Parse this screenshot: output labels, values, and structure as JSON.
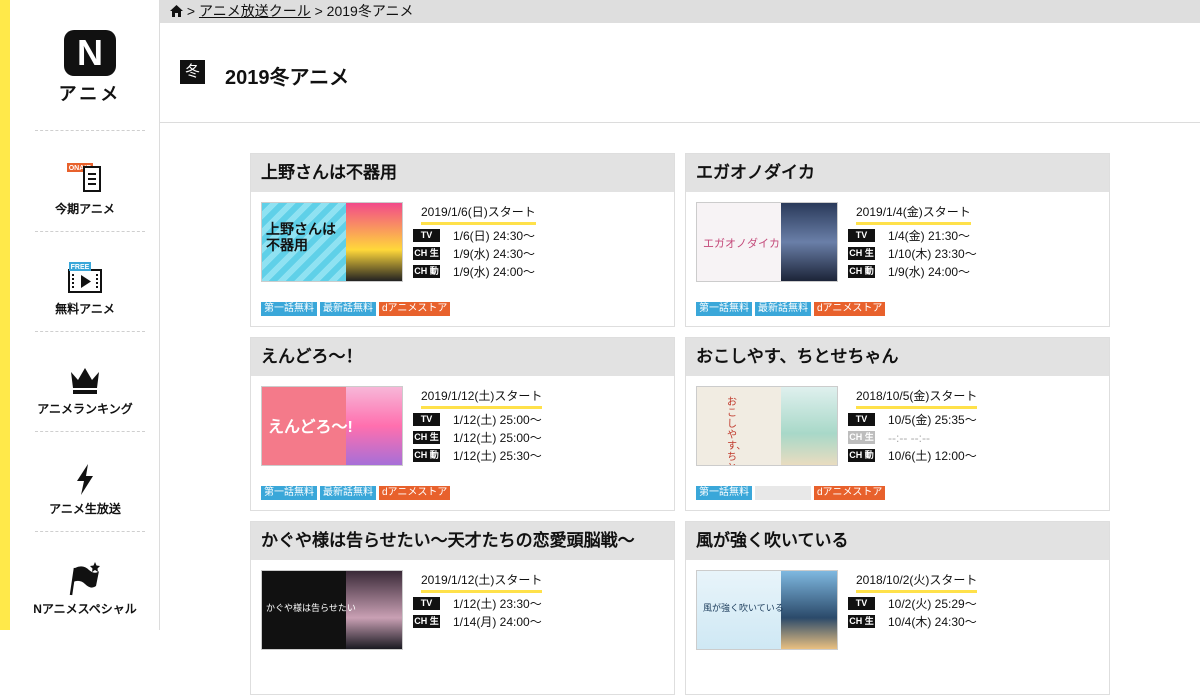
{
  "brand": {
    "logo_letter": "N",
    "logo_text": "アニメ"
  },
  "breadcrumb": {
    "sep": ">",
    "parent": "アニメ放送クール",
    "current": "2019冬アニメ"
  },
  "header": {
    "season_badge": "冬",
    "title": "2019冬アニメ"
  },
  "sidebar": {
    "items": [
      {
        "label": "今期アニメ",
        "icon": "onair-icon",
        "icon_text": "ONAIR"
      },
      {
        "label": "無料アニメ",
        "icon": "free-film-icon",
        "icon_text": "FREE"
      },
      {
        "label": "アニメランキング",
        "icon": "crown-icon"
      },
      {
        "label": "アニメ生放送",
        "icon": "lightning-icon"
      },
      {
        "label": "Nアニメスペシャル",
        "icon": "flag-icon"
      }
    ]
  },
  "tag_labels": {
    "tv": "TV",
    "ch_live": "CH 生",
    "ch_vod": "CH 動"
  },
  "badge_labels": {
    "first_free": "第一話無料",
    "latest_free": "最新話無料",
    "store": "dアニメストア"
  },
  "cards": [
    {
      "title": "上野さんは不器用",
      "start": "2019/1/6(日)スタート",
      "thumb_text": "上野さんは不器用",
      "tv": "1/6(日) 24:30～",
      "ch_live": "1/9(水) 24:30～",
      "ch_vod": "1/9(水) 24:00～"
    },
    {
      "title": "エガオノダイカ",
      "start": "2019/1/4(金)スタート",
      "thumb_text": "エガオノダイカ",
      "tv": "1/4(金) 21:30～",
      "ch_live": "1/10(木) 23:30～",
      "ch_vod": "1/9(水) 24:00～"
    },
    {
      "title": "えんどろ〜！",
      "start": "2019/1/12(土)スタート",
      "thumb_text": "えんどろ～!",
      "tv": "1/12(土) 25:00～",
      "ch_live": "1/12(土) 25:00～",
      "ch_vod": "1/12(土) 25:30～"
    },
    {
      "title": "おこしやす、ちとせちゃん",
      "start": "2018/10/5(金)スタート",
      "thumb_text": "おこしやす、ちとせちゃん",
      "tv": "10/5(金) 25:35～",
      "ch_live": "--:-- --:--",
      "ch_vod": "10/6(土) 12:00～"
    },
    {
      "title": "かぐや様は告らせたい～天才たちの恋愛頭脳戦～",
      "start": "2019/1/12(土)スタート",
      "thumb_text": "かぐや様は告らせたい",
      "tv": "1/12(土) 23:30～",
      "ch_live": "1/14(月) 24:00～"
    },
    {
      "title": "風が強く吹いている",
      "start": "2018/10/2(火)スタート",
      "thumb_text": "風が強く吹いている",
      "tv": "10/2(火) 25:29～",
      "ch_live": "10/4(木) 24:30～"
    }
  ]
}
